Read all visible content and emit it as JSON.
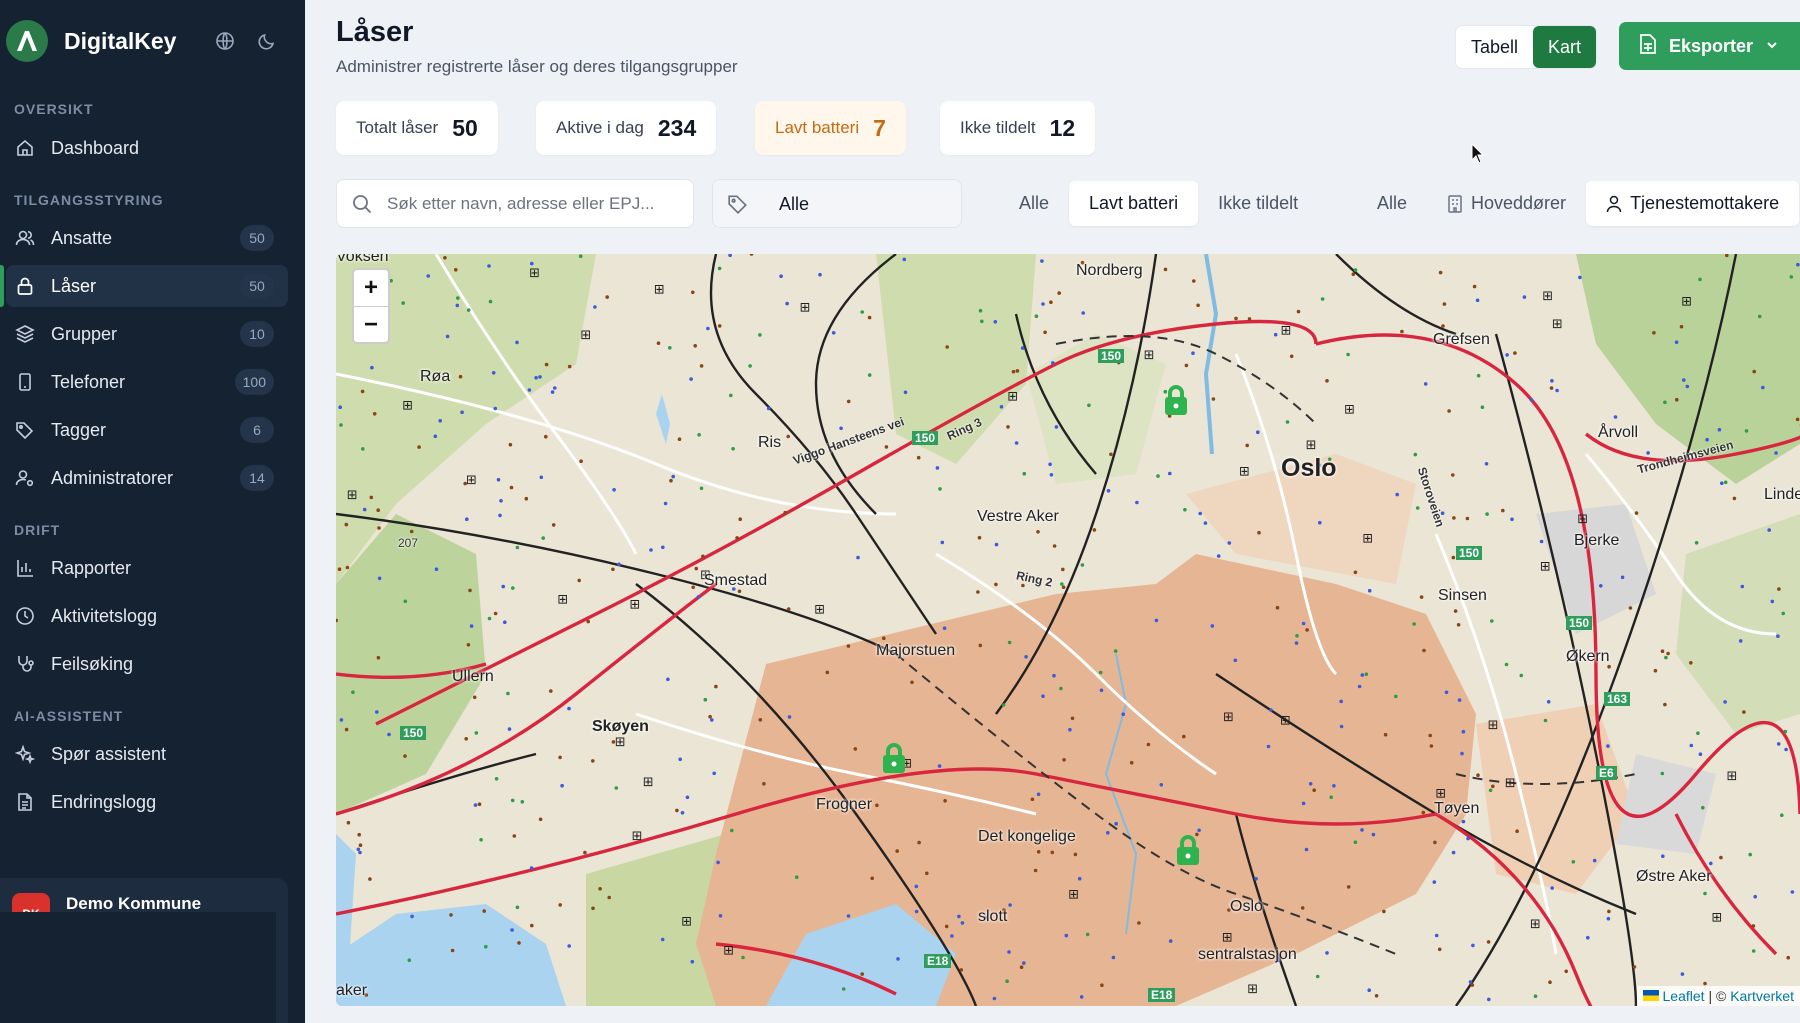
{
  "app": {
    "name": "DigitalKey",
    "colors": {
      "sidebar_bg": "#152232",
      "accent": "#2f9e5c",
      "warning": "#c56a12"
    }
  },
  "sidebar": {
    "sections": [
      {
        "label": "OVERSIKT"
      },
      {
        "label": "TILGANGSSTYRING"
      },
      {
        "label": "DRIFT"
      },
      {
        "label": "AI-ASSISTENT"
      }
    ],
    "items": [
      {
        "label": "Dashboard",
        "icon": "home-icon"
      },
      {
        "label": "Ansatte",
        "badge": "50",
        "icon": "users-icon"
      },
      {
        "label": "Låser",
        "badge": "50",
        "icon": "lock-icon",
        "active": true
      },
      {
        "label": "Grupper",
        "badge": "10",
        "icon": "layers-icon"
      },
      {
        "label": "Telefoner",
        "badge": "100",
        "icon": "phone-icon"
      },
      {
        "label": "Tagger",
        "badge": "6",
        "icon": "tag-icon"
      },
      {
        "label": "Administratorer",
        "badge": "14",
        "icon": "user-cog-icon"
      },
      {
        "label": "Rapporter",
        "icon": "bar-chart-icon"
      },
      {
        "label": "Aktivitetslogg",
        "icon": "clock-icon"
      },
      {
        "label": "Feilsøking",
        "icon": "stethoscope-icon"
      },
      {
        "label": "Spør assistent",
        "icon": "sparkles-icon"
      },
      {
        "label": "Endringslogg",
        "icon": "file-text-icon"
      }
    ],
    "org": {
      "initials": "DK",
      "name": "Demo Kommune"
    }
  },
  "header": {
    "title": "Låser",
    "subtitle": "Administrer registrerte låser og deres tilgangsgrupper",
    "view_table": "Tabell",
    "view_map": "Kart",
    "export": "Eksporter"
  },
  "stats": [
    {
      "label": "Totalt låser",
      "value": "50"
    },
    {
      "label": "Aktive i dag",
      "value": "234"
    },
    {
      "label": "Lavt batteri",
      "value": "7",
      "warning": true
    },
    {
      "label": "Ikke tildelt",
      "value": "12"
    }
  ],
  "filters": {
    "search_placeholder": "Søk etter navn, adresse eller EPJ...",
    "tag_value": "Alle",
    "status": [
      "Alle",
      "Lavt batteri",
      "Ikke tildelt"
    ],
    "status_selected": "Lavt batteri",
    "type": [
      "Alle",
      "Hoveddører",
      "Tjenestemottakere"
    ],
    "type_selected": "Tjenestemottakere"
  },
  "map": {
    "zoom_in": "+",
    "zoom_out": "−",
    "places": [
      "Voksen",
      "Nordberg",
      "Grefsen",
      "Røa",
      "Ris",
      "Viggo Hansteens vei",
      "Ring 3",
      "Oslo",
      "Årvoll",
      "Trondheimsveien",
      "Linde",
      "Vestre Aker",
      "Storoveien",
      "Bjerke",
      "Smestad",
      "Ring 2",
      "Sinsen",
      "Majorstuen",
      "Økern",
      "Ullern",
      "Skøyen",
      "Frogner",
      "Tøyen",
      "Det kongelige",
      "Østre Aker",
      "slott",
      "Oslo",
      "sentralstasjon",
      "aker"
    ],
    "road_numbers": [
      "150",
      "150",
      "150",
      "150",
      "150",
      "163",
      "E6",
      "E18",
      "E18",
      "207"
    ],
    "attribution_leaflet": "Leaflet",
    "attribution_sep": "| ©",
    "attribution_source": "Kartverket"
  }
}
